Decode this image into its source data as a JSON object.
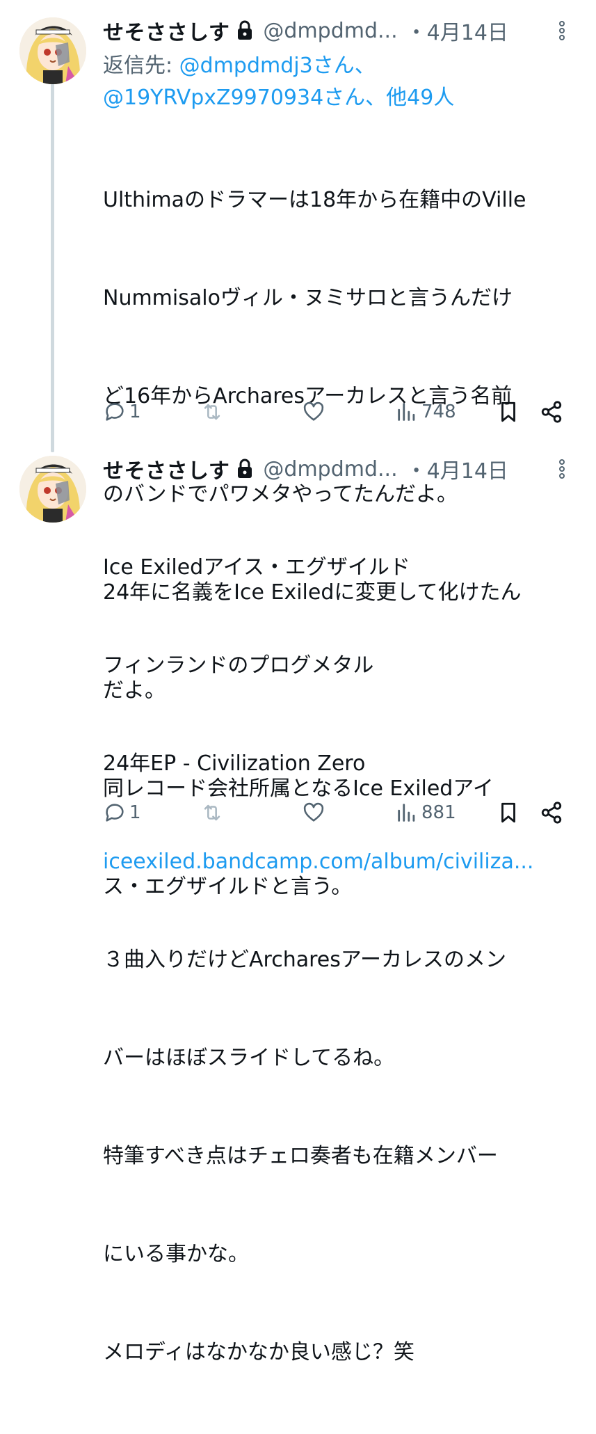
{
  "tweets": [
    {
      "display_name": "せそささしす",
      "handle": "@dmpdmd...",
      "date": "・4月14日",
      "reply_label": "返信先: ",
      "reply_mentions": "@dmpdmdj3さん、@19YRVpxZ9970934さん、他49人",
      "lines": [
        "Ulthimaのドラマーは18年から在籍中のVille",
        "Nummisaloヴィル・ヌミサロと言うんだけ",
        "ど16年からArcharesアーカレスと言う名前",
        "のバンドでパワメタやってたんだよ。",
        "24年に名義をIce Exiledに変更して化けたん",
        "だよ。",
        "同レコード会社所属となるIce Exiledアイ",
        "ス・エグザイルドと言う。"
      ],
      "replies": "1",
      "views": "748"
    },
    {
      "display_name": "せそささしす",
      "handle": "@dmpdmd...",
      "date": "・4月14日",
      "lines": [
        "Ice Exiledアイス・エグザイルド",
        "フィンランドのプログメタル",
        "24年EP - Civilization Zero"
      ],
      "link": "iceexiled.bandcamp.com/album/civiliza...",
      "lines_after": [
        "３曲入りだけどArcharesアーカレスのメン",
        "バーはほぼスライドしてるね。",
        "特筆すべき点はチェロ奏者も在籍メンバー",
        "にいる事かな。",
        "メロディはなかなか良い感じ？笑"
      ],
      "replies": "1",
      "views": "881"
    }
  ],
  "colors": {
    "text": "#0f1419",
    "muted": "#536471",
    "link": "#1d9bf0",
    "line": "#cfd9de"
  }
}
